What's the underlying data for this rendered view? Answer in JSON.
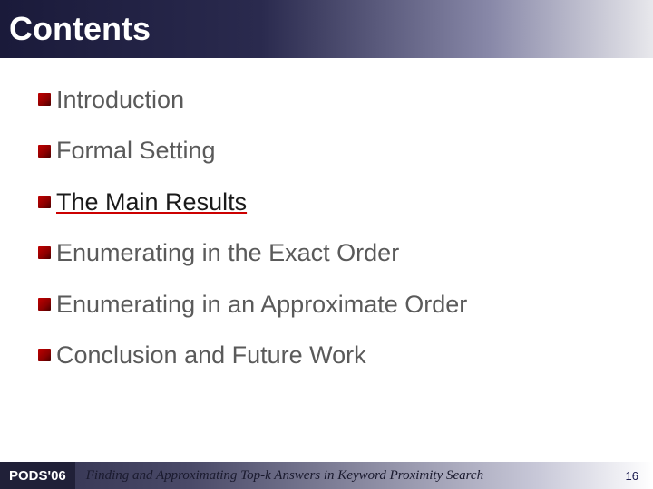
{
  "title": "Contents",
  "items": [
    {
      "text": "Introduction",
      "active": false
    },
    {
      "text": "Formal Setting",
      "active": false
    },
    {
      "text": "The Main Results",
      "active": true
    },
    {
      "text": "Enumerating in the Exact Order",
      "active": false
    },
    {
      "text": "Enumerating in an Approximate Order",
      "active": false
    },
    {
      "text": "Conclusion and Future Work",
      "active": false
    }
  ],
  "footer": {
    "tag": "PODS'06",
    "title": "Finding and Approximating Top-k Answers in Keyword Proximity Search",
    "page": "16"
  }
}
